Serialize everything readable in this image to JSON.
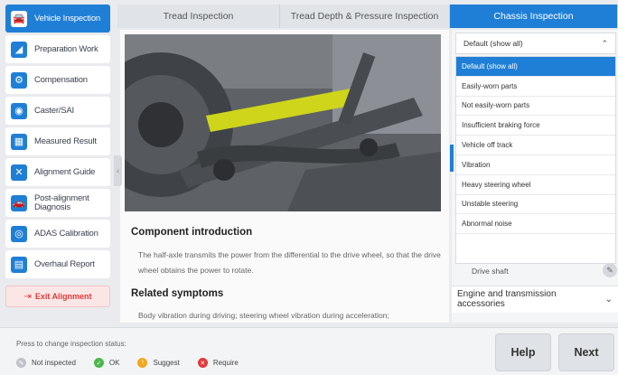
{
  "sidebar": {
    "items": [
      {
        "label": "Vehicle Inspection",
        "icon": "car-icon",
        "active": true
      },
      {
        "label": "Preparation Work",
        "icon": "lift-icon"
      },
      {
        "label": "Compensation",
        "icon": "compensation-icon"
      },
      {
        "label": "Caster/SAI",
        "icon": "steering-wheel-icon"
      },
      {
        "label": "Measured Result",
        "icon": "result-icon"
      },
      {
        "label": "Alignment Guide",
        "icon": "wrench-icon"
      },
      {
        "label": "Post-alignment Diagnosis",
        "icon": "car-diagnosis-icon"
      },
      {
        "label": "ADAS Calibration",
        "icon": "radar-icon"
      },
      {
        "label": "Overhaul Report",
        "icon": "document-icon"
      }
    ],
    "exit_label": "Exit Alignment"
  },
  "tabs": [
    {
      "label": "Tread Inspection"
    },
    {
      "label": "Tread Depth & Pressure Inspection"
    },
    {
      "label": "Chassis Inspection",
      "active": true
    }
  ],
  "main": {
    "component_title": "Component introduction",
    "component_text": "The half-axle transmits the power from the differential to the drive wheel, so that the drive wheel obtains the power to rotate.",
    "symptoms_title": "Related symptoms",
    "symptoms_text": "Body vibration during driving; steering wheel vibration during acceleration;"
  },
  "filter": {
    "selected": "Default (show all)",
    "options": [
      "Default (show all)",
      "Easily-worn parts",
      "Not easily-worn parts",
      "Insufficient braking force",
      "Vehicle off track",
      "Vibration",
      "Heavy steering wheel",
      "Unstable steering",
      "Abnormal noise"
    ]
  },
  "right": {
    "drive_shaft": "Drive shaft",
    "engine_group": "Engine and transmission accessories"
  },
  "bottom": {
    "hint": "Press to change inspection status:",
    "legend": [
      {
        "label": "Not inspected",
        "color": "#bfc3c8",
        "icon": "pencil-icon"
      },
      {
        "label": "OK",
        "color": "#4cb84c",
        "icon": "check-icon"
      },
      {
        "label": "Suggest",
        "color": "#f0a81e",
        "icon": "exclamation-icon"
      },
      {
        "label": "Require",
        "color": "#e03a3a",
        "icon": "cross-icon"
      }
    ],
    "help_label": "Help",
    "next_label": "Next"
  },
  "colors": {
    "accent": "#1f7fd6",
    "highlight_part": "#d4e21a"
  }
}
